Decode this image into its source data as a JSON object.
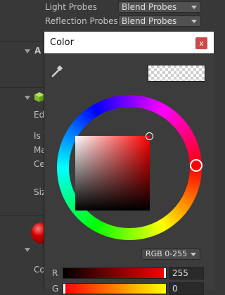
{
  "inspector": {
    "light_probes_label": "Light Probes",
    "light_probes_value": "Blend Probes",
    "reflection_probes_label": "Reflection Probes",
    "reflection_probes_value": "Blend Probes",
    "section_a": "A",
    "row_ed": "Ed",
    "row_is": "Is T",
    "row_ma": "Ma",
    "row_ce": "Ce",
    "row_siz": "Siz",
    "row_co": "Co"
  },
  "color_picker": {
    "title": "Color",
    "close_label": "x",
    "mode": "RGB 0-255",
    "channels": [
      {
        "label": "R",
        "value": "255",
        "fraction": 1.0
      },
      {
        "label": "G",
        "value": "0",
        "fraction": 0.0
      }
    ],
    "current_color": "#ff0000",
    "hue_degrees": 0,
    "saturation": 0.95,
    "brightness": 0.95
  }
}
